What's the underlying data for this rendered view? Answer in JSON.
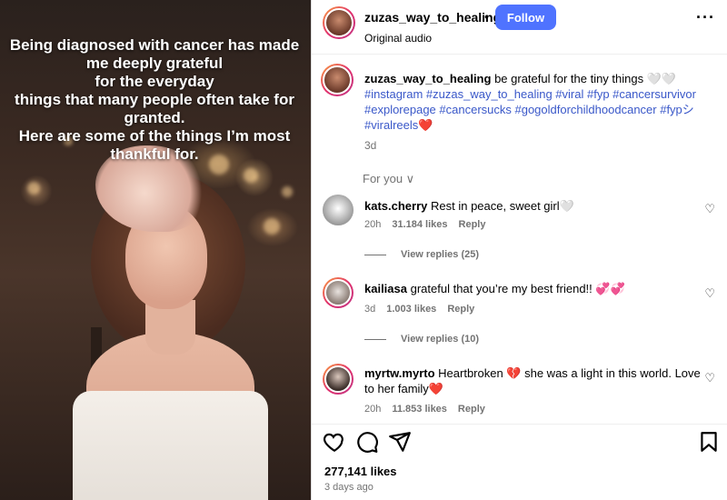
{
  "media": {
    "overlay_text": "Being diagnosed with cancer has made me deeply grateful\nfor the everyday\nthings that many people often take for granted.\nHere are some of the things I’m most thankful for."
  },
  "header": {
    "username": "zuzas_way_to_healing",
    "dot": "•",
    "follow_label": "Follow",
    "audio": "Original audio",
    "more_icon": "more-icon"
  },
  "caption": {
    "username": "zuzas_way_to_healing",
    "text": " be grateful for the tiny things 🤍🤍",
    "tags": "#instagram #zuzas_way_to_healing #viral #fyp #cancersurvivor #explorepage #cancersucks #gogoldforchildhoodcancer #fypシ #viralreels",
    "tags_suffix": "❤️",
    "time": "3d"
  },
  "for_you": "For you ∨",
  "comments": [
    {
      "username": "kats.cherry",
      "text": " Rest in peace, sweet girl🤍",
      "time": "20h",
      "likes": "31.184 likes",
      "reply": "Reply",
      "view_replies": "View replies (25)"
    },
    {
      "username": "kailiasa",
      "text": " grateful that you’re my best friend!! 💞💞",
      "time": "3d",
      "likes": "1.003 likes",
      "reply": "Reply",
      "view_replies": "View replies (10)"
    },
    {
      "username": "myrtw.myrto",
      "text": " Heartbroken 💔 she was a light in this world. Love to her family❤️",
      "time": "20h",
      "likes": "11.853 likes",
      "reply": "Reply"
    }
  ],
  "actions": {
    "like_icon": "heart-icon",
    "comment_icon": "comment-icon",
    "share_icon": "share-icon",
    "save_icon": "bookmark-icon"
  },
  "likes": "277,141 likes",
  "post_time": "3 days ago",
  "colors": {
    "follow": "#4f73ff",
    "hashtag": "#3a58c9",
    "muted": "#737373"
  }
}
